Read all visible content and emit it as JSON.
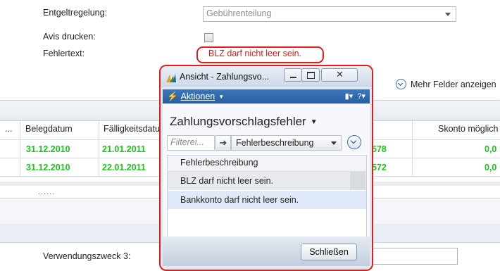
{
  "form": {
    "entgelt_label": "Entgeltregelung:",
    "entgelt_value": "Gebührenteilung",
    "avis_label": "Avis drucken:",
    "fehler_label": "Fehlertext:",
    "fehler_value": "BLZ darf nicht leer sein.",
    "more_fields": "Mehr Felder anzeigen",
    "verwendungszweck_label": "Verwendungszweck 3:"
  },
  "table": {
    "headers": [
      "...",
      "Belegdatum",
      "Fälligkeitsdatum",
      "Skonto möglich"
    ],
    "rows": [
      {
        "belegdatum": "31.12.2010",
        "faellig": "21.01.2011",
        "mid": "578",
        "skonto": "0,0"
      },
      {
        "belegdatum": "31.12.2010",
        "faellig": "22.01.2011",
        "mid": "572",
        "skonto": "0,0"
      }
    ],
    "dots": "......"
  },
  "dialog": {
    "title": "Ansicht - Zahlungsvo...",
    "actions_label": "Aktionen",
    "panel_title": "Zahlungsvorschlagsfehler",
    "filter_placeholder": "Filterei...",
    "filter_field": "Fehlerbeschreibung",
    "column_header": "Fehlerbeschreibung",
    "rows": [
      "BLZ darf nicht leer sein.",
      "Bankkonto darf nicht leer sein."
    ],
    "close_button": "Schließen"
  },
  "colors": {
    "error_red": "#e51c1c",
    "green_values": "#1cc41c",
    "action_blue": "#2a5e9f"
  }
}
